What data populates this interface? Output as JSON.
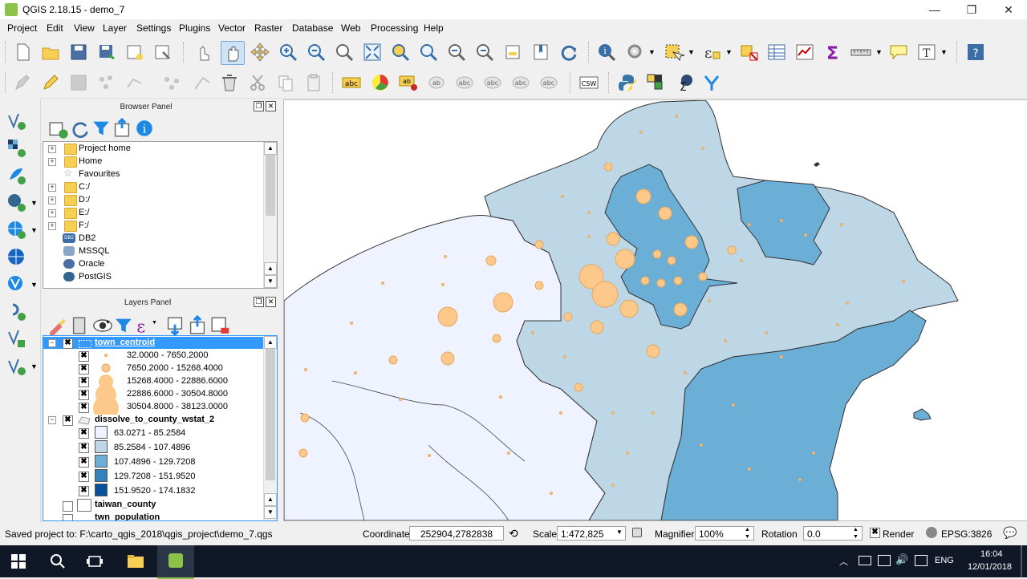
{
  "window": {
    "title": "QGIS 2.18.15 - demo_7",
    "minimize": "—",
    "maximize": "❐",
    "close": "✕"
  },
  "menu": [
    "Project",
    "Edit",
    "View",
    "Layer",
    "Settings",
    "Plugins",
    "Vector",
    "Raster",
    "Database",
    "Web",
    "Processing",
    "Help"
  ],
  "browser_panel": {
    "title": "Browser Panel",
    "items": [
      "Project home",
      "Home",
      "Favourites",
      "C:/",
      "D:/",
      "E:/",
      "F:/",
      "DB2",
      "MSSQL",
      "Oracle",
      "PostGIS"
    ]
  },
  "layers_panel": {
    "title": "Layers Panel",
    "layers": [
      {
        "name": "town_centroid",
        "checked": "✖",
        "expander": "−",
        "classes": [
          "32.0000 - 7650.2000",
          "7650.2000 - 15268.4000",
          "15268.4000 - 22886.6000",
          "22886.6000 - 30504.8000",
          "30504.8000 - 38123.0000"
        ]
      },
      {
        "name": "dissolve_to_county_wstat_2",
        "checked": "✖",
        "expander": "−",
        "classes": [
          "63.0271 - 85.2584",
          "85.2584 - 107.4896",
          "107.4896 - 129.7208",
          "129.7208 - 151.9520",
          "151.9520 - 174.1832"
        ],
        "colors": [
          "#eff3ff",
          "#bdd7e7",
          "#6baed6",
          "#3182bd",
          "#08519c"
        ]
      },
      {
        "name": "taiwan_county"
      },
      {
        "name": "twn_population"
      }
    ]
  },
  "status": {
    "message": "Saved project to: F:\\carto_qgis_2018\\qgis_project\\demo_7.qgs",
    "coordinate_label": "Coordinate",
    "coordinate_value": "252904,2782838",
    "scale_label": "Scale",
    "scale_value": "1:472,825",
    "magnifier_label": "Magnifier",
    "magnifier_value": "100%",
    "rotation_label": "Rotation",
    "rotation_value": "0.0",
    "render_label": "Render",
    "render_check": "✖",
    "crs": "EPSG:3826"
  },
  "taskbar": {
    "lang": "ENG",
    "time": "16:04",
    "date": "12/01/2018"
  },
  "colors": {
    "point_fill": "#fdc98a",
    "point_stroke": "#e6a760",
    "selection": "#3399ff"
  }
}
